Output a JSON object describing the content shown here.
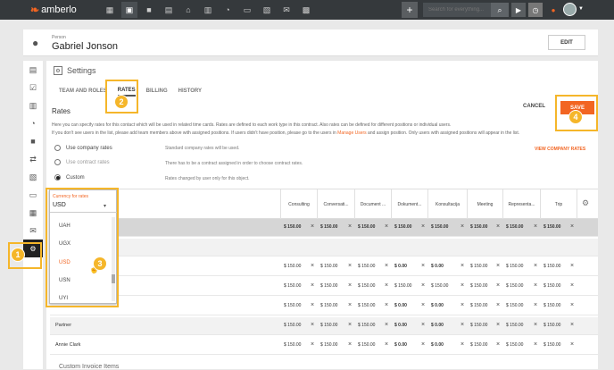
{
  "app": {
    "brand": "amberlo"
  },
  "topbar": {
    "search_placeholder": "Search for everything...",
    "icons": [
      "dashboard-icon",
      "contact-icon",
      "briefcase-icon",
      "document-icon",
      "bank-icon",
      "calendar-icon",
      "timer-icon",
      "folder-icon",
      "invoice-icon",
      "mail-icon",
      "chart-icon"
    ]
  },
  "person": {
    "label": "Person",
    "name": "Gabriel Jonson",
    "edit": "EDIT"
  },
  "settings": {
    "title": "Settings",
    "tabs": [
      "TEAM AND ROLES",
      "RATES",
      "BILLING",
      "HISTORY"
    ],
    "active_tab": "RATES"
  },
  "rates": {
    "heading": "Rates",
    "cancel": "CANCEL",
    "save": "SAVE",
    "desc1": "Here you can specify rates for this contact which will be used in related time cards. Rates are defined to each work type in this contract. Also rates can be defined for different positions or individual users.",
    "desc2a": "If you don't see users in the list, please add team members above with assigned positions. If users didn't have position, please go to the users in ",
    "desc2link": "Manage Users",
    "desc2b": " and assign position. Only users with assigned positions will appear in the list.",
    "options": [
      {
        "label": "Use company rates",
        "desc": "Standard company rates will be used.",
        "selected": false,
        "disabled": false
      },
      {
        "label": "Use contract rates",
        "desc": "There has to be a contract assigned in order to choose contract rates.",
        "selected": false,
        "disabled": true
      },
      {
        "label": "Custom",
        "desc": "Rates changed by user only for this object.",
        "selected": true,
        "disabled": false
      }
    ],
    "view_company_rates": "VIEW COMPANY RATES"
  },
  "currency": {
    "label": "Currency for rates",
    "value": "USD",
    "options": [
      "UAH",
      "UGX",
      "USD",
      "USN",
      "UYI"
    ],
    "selected": "USD"
  },
  "table": {
    "columns": [
      "Consulting",
      "Conversati...",
      "Document ...",
      "Dokument...",
      "Konsultacija",
      "Meeting",
      "Representa...",
      "Trip"
    ],
    "rows": [
      {
        "label": "",
        "style": "gray",
        "values": [
          "$ 150.00",
          "$ 150.00",
          "$ 150.00",
          "$ 150.00",
          "$ 150.00",
          "$ 150.00",
          "$ 150.00",
          "$ 150.00"
        ],
        "bold": true
      },
      {
        "label": "",
        "style": "band",
        "values": [
          "",
          "",
          "",
          "",
          "",
          "",
          "",
          ""
        ],
        "bold": false
      },
      {
        "label": "",
        "style": "",
        "values": [
          "$ 150.00",
          "$ 150.00",
          "$ 150.00",
          "$ 0.00",
          "$ 0.00",
          "$ 150.00",
          "$ 150.00",
          "$ 150.00"
        ],
        "bold": false
      },
      {
        "label": "",
        "style": "",
        "values": [
          "$ 150.00",
          "$ 150.00",
          "$ 150.00",
          "$ 150.00",
          "$ 150.00",
          "$ 150.00",
          "$ 150.00",
          "$ 150.00"
        ],
        "bold": false
      },
      {
        "label": "",
        "style": "",
        "values": [
          "$ 150.00",
          "$ 150.00",
          "$ 150.00",
          "$ 0.00",
          "$ 0.00",
          "$ 150.00",
          "$ 150.00",
          "$ 150.00"
        ],
        "bold": false
      },
      {
        "label": "Partner",
        "style": "band",
        "values": [
          "$ 150.00",
          "$ 150.00",
          "$ 150.00",
          "$ 0.00",
          "$ 0.00",
          "$ 150.00",
          "$ 150.00",
          "$ 150.00"
        ],
        "bold": false
      },
      {
        "label": "Annie Clark",
        "style": "",
        "values": [
          "$ 150.00",
          "$ 150.00",
          "$ 150.00",
          "$ 0.00",
          "$ 0.00",
          "$ 150.00",
          "$ 150.00",
          "$ 150.00"
        ],
        "bold": false
      }
    ]
  },
  "badges": [
    "1",
    "2",
    "3",
    "4"
  ],
  "bottom": {
    "text": "Custom Invoice Items"
  }
}
